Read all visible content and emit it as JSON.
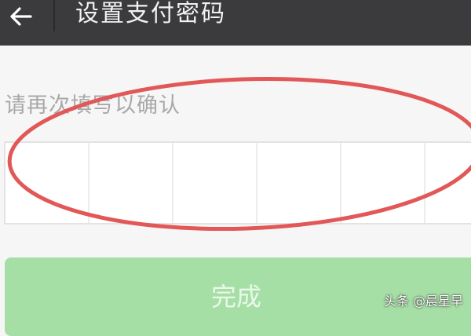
{
  "header": {
    "back_icon": "arrow-left-icon",
    "title": "设置支付密码"
  },
  "form": {
    "prompt": "请再次填写以确认",
    "pin_length": 6,
    "annotation_color": "#e25757"
  },
  "actions": {
    "done_label": "完成"
  },
  "watermark": "头条 @晨星早",
  "colors": {
    "titlebar": "#3b3b3d",
    "button": "#a6dfa6"
  }
}
